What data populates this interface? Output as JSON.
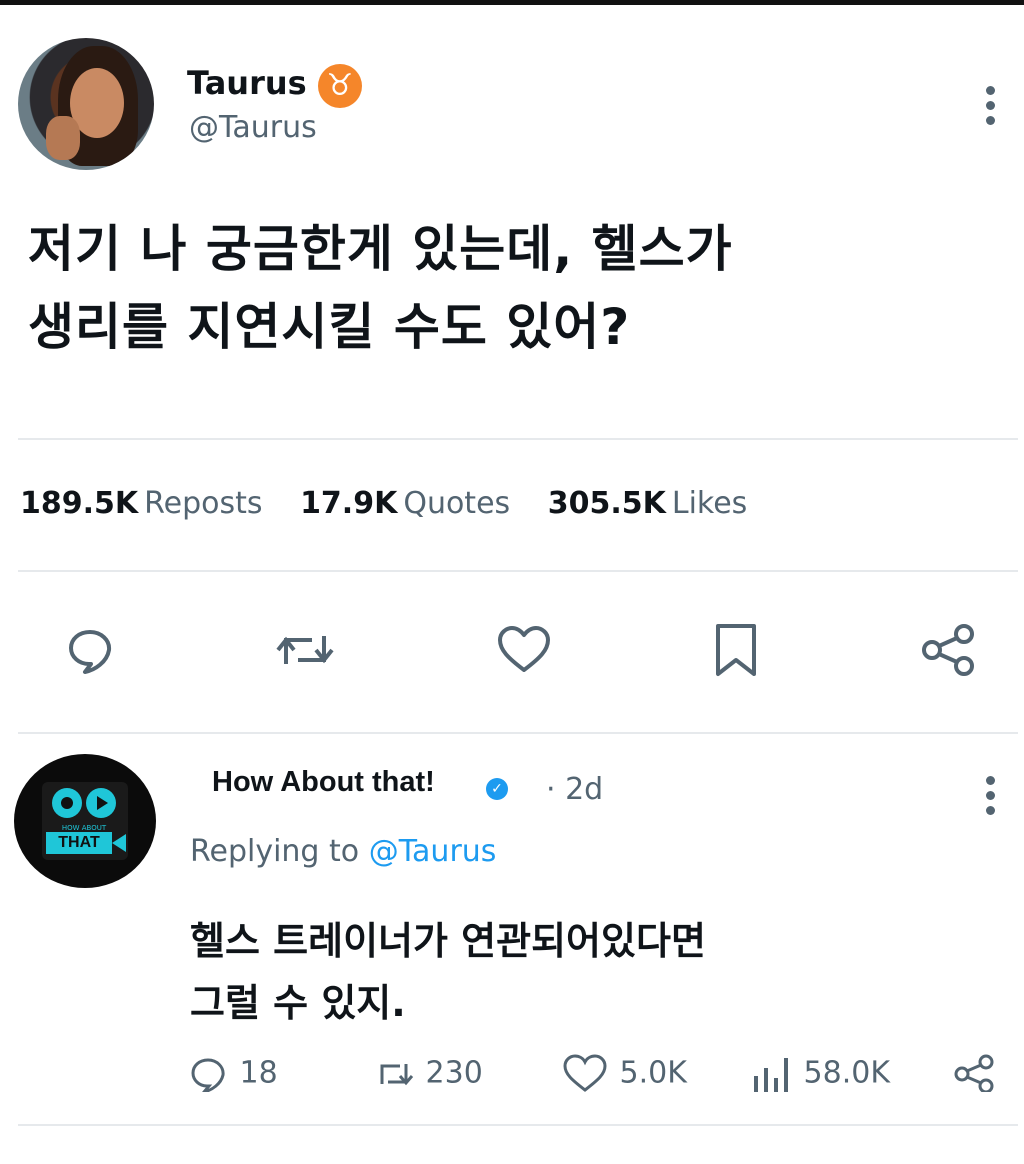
{
  "main_tweet": {
    "display_name": "Taurus",
    "badge_symbol": "♉",
    "handle": "@Taurus",
    "text_line1": "저기 나 궁금한게 있는데, 헬스가",
    "text_line2": "생리를 지연시킬 수도 있어?",
    "stats": {
      "reposts_count": "189.5K",
      "reposts_label": "Reposts",
      "quotes_count": "17.9K",
      "quotes_label": "Quotes",
      "likes_count": "305.5K",
      "likes_label": "Likes"
    },
    "actions": [
      "reply-icon",
      "repost-icon",
      "like-icon",
      "bookmark-icon",
      "share-icon"
    ]
  },
  "reply": {
    "display_name": "How About that!",
    "verified_symbol": "✓",
    "time": "· 2d",
    "replying_prefix": "Replying to",
    "replying_handle": "@Taurus",
    "avatar_text_small": "HOW ABOUT",
    "avatar_text_big": "THAT",
    "text_line1": "헬스 트레이너가 연관되어있다면",
    "text_line2": "그럴 수 있지.",
    "actions": {
      "replies": "18",
      "reposts": "230",
      "likes": "5.0K",
      "views": "58.0K"
    }
  },
  "colors": {
    "text_primary": "#0f1419",
    "text_secondary": "#536471",
    "accent_blue": "#1d9bf0",
    "taurus_badge": "#f5862a",
    "divider": "#e6e9ec"
  }
}
